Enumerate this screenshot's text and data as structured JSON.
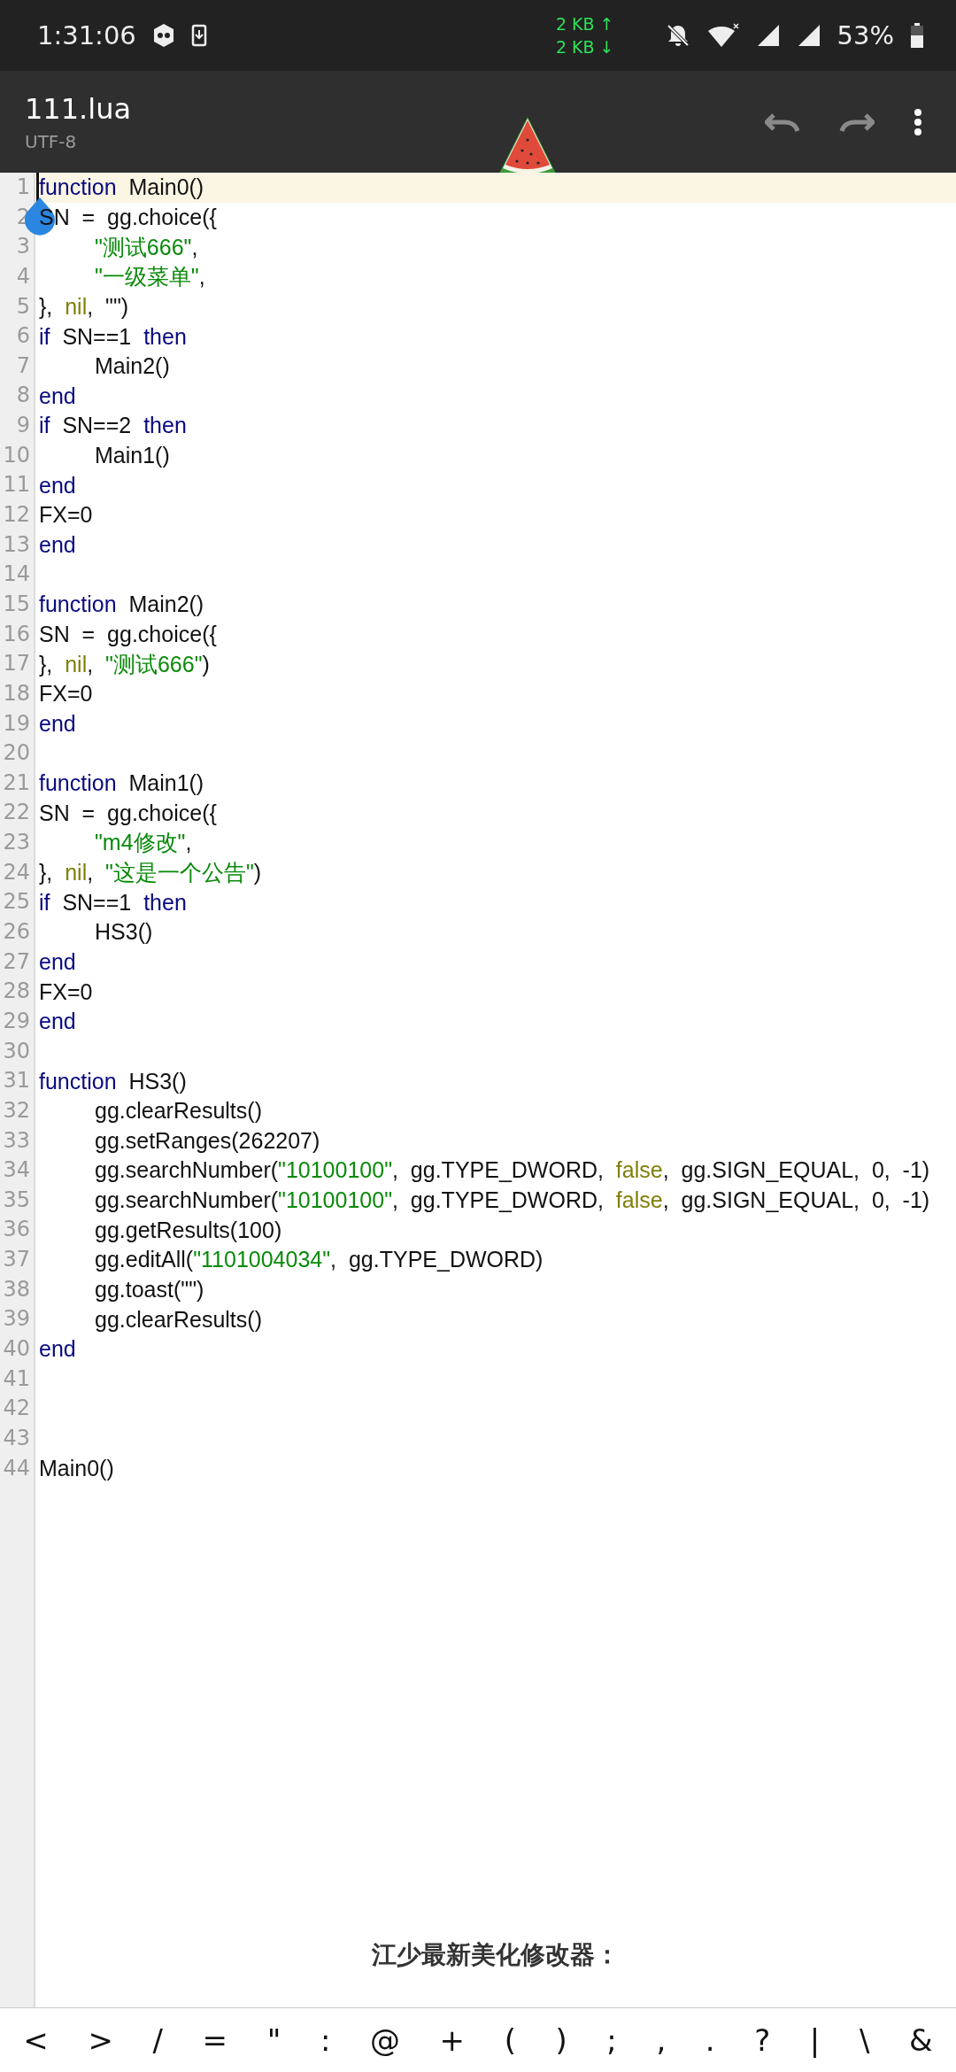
{
  "status_bar": {
    "time": "1:31:06",
    "upload": "2 KB ↑",
    "download": "2 KB ↓",
    "battery": "53%"
  },
  "toolbar": {
    "title": "111.lua",
    "encoding": "UTF-8"
  },
  "editor": {
    "lines": [
      {
        "number": "1",
        "current": true,
        "indented": false,
        "tokens": [
          {
            "kind": "keyword",
            "text": "function"
          },
          {
            "kind": "plain",
            "text": "  Main0()"
          }
        ]
      },
      {
        "number": "2",
        "current": false,
        "indented": false,
        "tokens": [
          {
            "kind": "plain",
            "text": "SN  =  gg.choice({"
          }
        ]
      },
      {
        "number": "3",
        "current": false,
        "indented": true,
        "tokens": [
          {
            "kind": "string",
            "text": "\"测试666\""
          },
          {
            "kind": "plain",
            "text": ","
          }
        ]
      },
      {
        "number": "4",
        "current": false,
        "indented": true,
        "tokens": [
          {
            "kind": "string",
            "text": "\"一级菜单\""
          },
          {
            "kind": "plain",
            "text": ","
          }
        ]
      },
      {
        "number": "5",
        "current": false,
        "indented": false,
        "tokens": [
          {
            "kind": "plain",
            "text": "},  "
          },
          {
            "kind": "constant",
            "text": "nil"
          },
          {
            "kind": "plain",
            "text": ",  \"\")"
          }
        ]
      },
      {
        "number": "6",
        "current": false,
        "indented": false,
        "tokens": [
          {
            "kind": "keyword",
            "text": "if"
          },
          {
            "kind": "plain",
            "text": "  SN==1  "
          },
          {
            "kind": "keyword",
            "text": "then"
          }
        ]
      },
      {
        "number": "7",
        "current": false,
        "indented": true,
        "tokens": [
          {
            "kind": "plain",
            "text": "Main2()"
          }
        ]
      },
      {
        "number": "8",
        "current": false,
        "indented": false,
        "tokens": [
          {
            "kind": "keyword",
            "text": "end"
          }
        ]
      },
      {
        "number": "9",
        "current": false,
        "indented": false,
        "tokens": [
          {
            "kind": "keyword",
            "text": "if"
          },
          {
            "kind": "plain",
            "text": "  SN==2  "
          },
          {
            "kind": "keyword",
            "text": "then"
          }
        ]
      },
      {
        "number": "10",
        "current": false,
        "indented": true,
        "tokens": [
          {
            "kind": "plain",
            "text": "Main1()"
          }
        ]
      },
      {
        "number": "11",
        "current": false,
        "indented": false,
        "tokens": [
          {
            "kind": "keyword",
            "text": "end"
          }
        ]
      },
      {
        "number": "12",
        "current": false,
        "indented": false,
        "tokens": [
          {
            "kind": "plain",
            "text": "FX=0"
          }
        ]
      },
      {
        "number": "13",
        "current": false,
        "indented": false,
        "tokens": [
          {
            "kind": "keyword",
            "text": "end"
          }
        ]
      },
      {
        "number": "14",
        "current": false
      },
      {
        "number": "15",
        "current": false,
        "indented": false,
        "tokens": [
          {
            "kind": "keyword",
            "text": "function"
          },
          {
            "kind": "plain",
            "text": "  Main2()"
          }
        ]
      },
      {
        "number": "16",
        "current": false,
        "indented": false,
        "tokens": [
          {
            "kind": "plain",
            "text": "SN  =  gg.choice({"
          }
        ]
      },
      {
        "number": "17",
        "current": false,
        "indented": false,
        "tokens": [
          {
            "kind": "plain",
            "text": "},  "
          },
          {
            "kind": "constant",
            "text": "nil"
          },
          {
            "kind": "plain",
            "text": ",  "
          },
          {
            "kind": "string",
            "text": "\"测试666\""
          },
          {
            "kind": "plain",
            "text": ")"
          }
        ]
      },
      {
        "number": "18",
        "current": false,
        "indented": false,
        "tokens": [
          {
            "kind": "plain",
            "text": "FX=0"
          }
        ]
      },
      {
        "number": "19",
        "current": false,
        "indented": false,
        "tokens": [
          {
            "kind": "keyword",
            "text": "end"
          }
        ]
      },
      {
        "number": "20",
        "current": false
      },
      {
        "number": "21",
        "current": false,
        "indented": false,
        "tokens": [
          {
            "kind": "keyword",
            "text": "function"
          },
          {
            "kind": "plain",
            "text": "  Main1()"
          }
        ]
      },
      {
        "number": "22",
        "current": false,
        "indented": false,
        "tokens": [
          {
            "kind": "plain",
            "text": "SN  =  gg.choice({"
          }
        ]
      },
      {
        "number": "23",
        "current": false,
        "indented": true,
        "tokens": [
          {
            "kind": "string",
            "text": "\"m4修改\""
          },
          {
            "kind": "plain",
            "text": ","
          }
        ]
      },
      {
        "number": "24",
        "current": false,
        "indented": false,
        "tokens": [
          {
            "kind": "plain",
            "text": "},  "
          },
          {
            "kind": "constant",
            "text": "nil"
          },
          {
            "kind": "plain",
            "text": ",  "
          },
          {
            "kind": "string",
            "text": "\"这是一个公告\""
          },
          {
            "kind": "plain",
            "text": ")"
          }
        ]
      },
      {
        "number": "25",
        "current": false,
        "indented": false,
        "tokens": [
          {
            "kind": "keyword",
            "text": "if"
          },
          {
            "kind": "plain",
            "text": "  SN==1  "
          },
          {
            "kind": "keyword",
            "text": "then"
          }
        ]
      },
      {
        "number": "26",
        "current": false,
        "indented": true,
        "tokens": [
          {
            "kind": "plain",
            "text": "HS3()"
          }
        ]
      },
      {
        "number": "27",
        "current": false,
        "indented": false,
        "tokens": [
          {
            "kind": "keyword",
            "text": "end"
          }
        ]
      },
      {
        "number": "28",
        "current": false,
        "indented": false,
        "tokens": [
          {
            "kind": "plain",
            "text": "FX=0"
          }
        ]
      },
      {
        "number": "29",
        "current": false,
        "indented": false,
        "tokens": [
          {
            "kind": "keyword",
            "text": "end"
          }
        ]
      },
      {
        "number": "30",
        "current": false
      },
      {
        "number": "31",
        "current": false,
        "indented": false,
        "tokens": [
          {
            "kind": "keyword",
            "text": "function"
          },
          {
            "kind": "plain",
            "text": "  HS3()"
          }
        ]
      },
      {
        "number": "32",
        "current": false,
        "indented": true,
        "tokens": [
          {
            "kind": "plain",
            "text": "gg.clearResults()"
          }
        ]
      },
      {
        "number": "33",
        "current": false,
        "indented": true,
        "tokens": [
          {
            "kind": "plain",
            "text": "gg.setRanges(262207)"
          }
        ]
      },
      {
        "number": "34",
        "current": false,
        "indented": true,
        "tokens": [
          {
            "kind": "plain",
            "text": "gg.searchNumber("
          },
          {
            "kind": "string",
            "text": "\"10100100\""
          },
          {
            "kind": "plain",
            "text": ",  gg.TYPE_DWORD,  "
          },
          {
            "kind": "constant",
            "text": "false"
          },
          {
            "kind": "plain",
            "text": ",  gg.SIGN_EQUAL,  0,  -1)"
          }
        ]
      },
      {
        "number": "35",
        "current": false,
        "indented": true,
        "tokens": [
          {
            "kind": "plain",
            "text": "gg.searchNumber("
          },
          {
            "kind": "string",
            "text": "\"10100100\""
          },
          {
            "kind": "plain",
            "text": ",  gg.TYPE_DWORD,  "
          },
          {
            "kind": "constant",
            "text": "false"
          },
          {
            "kind": "plain",
            "text": ",  gg.SIGN_EQUAL,  0,  -1)"
          }
        ]
      },
      {
        "number": "36",
        "current": false,
        "indented": true,
        "tokens": [
          {
            "kind": "plain",
            "text": "gg.getResults(100)"
          }
        ]
      },
      {
        "number": "37",
        "current": false,
        "indented": true,
        "tokens": [
          {
            "kind": "plain",
            "text": "gg.editAll("
          },
          {
            "kind": "string",
            "text": "\"1101004034\""
          },
          {
            "kind": "plain",
            "text": ",  gg.TYPE_DWORD)"
          }
        ]
      },
      {
        "number": "38",
        "current": false,
        "indented": true,
        "tokens": [
          {
            "kind": "plain",
            "text": "gg.toast(\"\")"
          }
        ]
      },
      {
        "number": "39",
        "current": false,
        "indented": true,
        "tokens": [
          {
            "kind": "plain",
            "text": "gg.clearResults()"
          }
        ]
      },
      {
        "number": "40",
        "current": false,
        "indented": false,
        "tokens": [
          {
            "kind": "keyword",
            "text": "end"
          }
        ]
      },
      {
        "number": "41",
        "current": false
      },
      {
        "number": "42",
        "current": false
      },
      {
        "number": "43",
        "current": false
      },
      {
        "number": "44",
        "current": false,
        "indented": false,
        "tokens": [
          {
            "kind": "plain",
            "text": "Main0()"
          }
        ]
      }
    ],
    "overlay_text": "江少最新美化修改器："
  },
  "symbol_bar": [
    "<",
    ">",
    "/",
    "=",
    "\"",
    ":",
    "@",
    "+",
    "(",
    ")",
    ";",
    ",",
    ".",
    "?",
    "|",
    "\\",
    "&"
  ]
}
